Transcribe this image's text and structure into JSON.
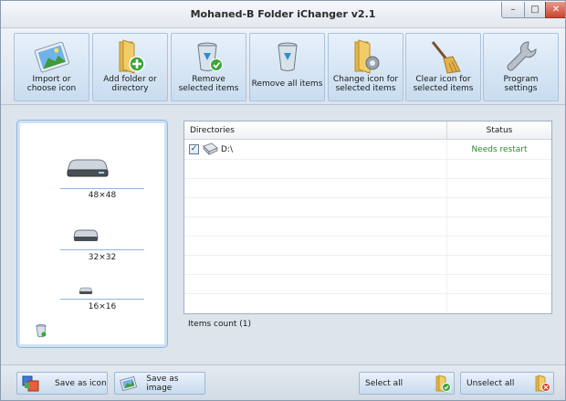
{
  "window": {
    "title": "Mohaned-B Folder iChanger v2.1"
  },
  "titlebar": {
    "minimize": "–",
    "maximize": "□",
    "close": "✕"
  },
  "toolbar": [
    {
      "label": "Import or\nchoose icon",
      "icon": "image-import-icon"
    },
    {
      "label": "Add folder or\ndirectory",
      "icon": "folder-add-icon"
    },
    {
      "label": "Remove\nselected items",
      "icon": "recycle-bin-check-icon"
    },
    {
      "label": "Remove all items",
      "icon": "recycle-bin-icon"
    },
    {
      "label": "Change icon for\nselected items",
      "icon": "folder-gear-icon"
    },
    {
      "label": "Clear icon for\nselected items",
      "icon": "broom-icon"
    },
    {
      "label": "Program\nsettings",
      "icon": "wrench-icon"
    }
  ],
  "preview": {
    "sizes": [
      {
        "label": "48×48"
      },
      {
        "label": "32×32"
      },
      {
        "label": "16×16"
      }
    ],
    "recycle_icon": "recycle-bin-small-icon"
  },
  "list": {
    "columns": {
      "directories": "Directories",
      "status": "Status"
    },
    "rows": [
      {
        "checked": true,
        "path": "D:\\",
        "status": "Needs restart"
      }
    ],
    "items_count": "Items count (1)"
  },
  "bottombar": {
    "save_icon": "Save as icon",
    "save_image": "Save as image",
    "select_all": "Select all",
    "unselect_all": "Unselect all"
  },
  "colors": {
    "status_ok": "#2a8a2a",
    "accent_border": "#8fb6dd",
    "close_button": "#c7472e"
  }
}
